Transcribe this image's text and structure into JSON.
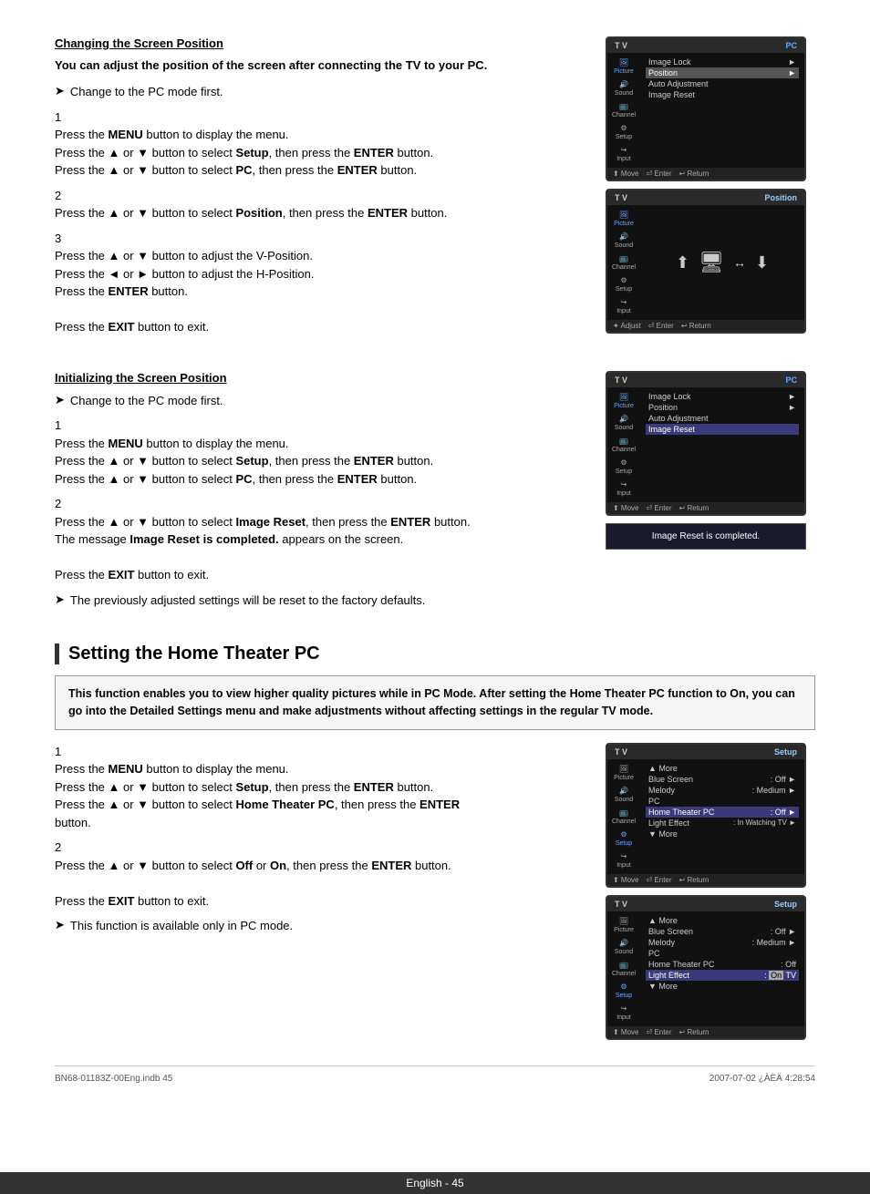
{
  "page": {
    "background": "#ffffff"
  },
  "section1": {
    "title": "Changing the Screen Position",
    "intro": "You can adjust the position of the screen after connecting the TV to your PC.",
    "arrow1": "Change to the PC mode first.",
    "step1_num": "1",
    "step1_line1": "Press the ",
    "step1_menu": "MENU",
    "step1_line1b": " button to display the menu.",
    "step1_line2a": "Press the ▲ or ▼ button to select ",
    "step1_setup": "Setup",
    "step1_line2b": ", then press the ",
    "step1_enter": "ENTER",
    "step1_line2c": " button.",
    "step1_line3a": "Press the ▲ or ▼ button to select ",
    "step1_pc": "PC",
    "step1_line3b": ", then press the ",
    "step1_enter2": "ENTER",
    "step1_line3c": " button.",
    "step2_num": "2",
    "step2_line1a": "Press the ▲ or ▼ button to select ",
    "step2_position": "Position",
    "step2_line1b": ", then press the ",
    "step2_enter": "ENTER",
    "step2_line1c": " button.",
    "step3_num": "3",
    "step3_line1": "Press the ▲ or ▼ button to adjust the V-Position.",
    "step3_line2": "Press the ◄ or ► button to adjust the H-Position.",
    "step3_line3a": "Press the ",
    "step3_enter": "ENTER",
    "step3_line3b": " button.",
    "step3_line4a": "Press the ",
    "step3_exit": "EXIT",
    "step3_line4b": " button to exit."
  },
  "tv1": {
    "header_tv": "T V",
    "header_pc": "PC",
    "menu_items": [
      {
        "label": "Image Lock",
        "arrow": "►",
        "selected": false
      },
      {
        "label": "Position",
        "arrow": "►",
        "selected": true
      },
      {
        "label": "Auto Adjustment",
        "arrow": "",
        "selected": false
      },
      {
        "label": "Image Reset",
        "arrow": "",
        "selected": false
      }
    ],
    "side_icons": [
      "Picture",
      "Sound",
      "Channel",
      "Setup",
      "Input"
    ],
    "footer": "⬆ Move  ⏎ Enter  ↩ Return"
  },
  "tv2": {
    "header_tv": "T V",
    "header_position": "Position",
    "side_icons": [
      "Picture",
      "Sound",
      "Channel",
      "Setup",
      "Input"
    ],
    "footer": "✦ Adjust  ⏎ Enter  ↩ Return"
  },
  "section2": {
    "title": "Initializing the Screen Position",
    "arrow1": "Change to the PC mode first.",
    "step1_num": "1",
    "step1_line1a": "Press the ",
    "step1_menu": "MENU",
    "step1_line1b": " button to display the menu.",
    "step1_line2a": "Press the ▲ or ▼ button to select ",
    "step1_setup": "Setup",
    "step1_line2b": ", then press the ",
    "step1_enter": "ENTER",
    "step1_line2c": " button.",
    "step1_line3a": "Press the ▲ or ▼ button to select ",
    "step1_pc": "PC",
    "step1_line3b": ", then press the ",
    "step1_enter2": "ENTER",
    "step1_line3c": " button.",
    "step2_num": "2",
    "step2_line1a": "Press the ▲ or ▼ button to select ",
    "step2_imgReset": "Image Reset",
    "step2_line1b": ", then press the ",
    "step2_enter": "ENTER",
    "step2_line1c": " button.",
    "step2_line2a": "The message ",
    "step2_msgBold": "Image Reset is completed.",
    "step2_line2b": " appears on the screen.",
    "step2_line3a": "Press the ",
    "step2_exit": "EXIT",
    "step2_line3b": " button to exit.",
    "arrow2": "The previously adjusted settings will be reset to the factory defaults."
  },
  "tv3": {
    "header_tv": "T V",
    "header_pc": "PC",
    "menu_items": [
      {
        "label": "Image Lock",
        "arrow": "►",
        "selected": false
      },
      {
        "label": "Position",
        "arrow": "►",
        "selected": false
      },
      {
        "label": "Auto Adjustment",
        "arrow": "",
        "selected": false
      },
      {
        "label": "Image Reset",
        "arrow": "",
        "selected": true
      }
    ],
    "side_icons": [
      "Picture",
      "Sound",
      "Channel",
      "Setup",
      "Input"
    ],
    "footer": "⬆ Move  ⏎ Enter  ↩ Return"
  },
  "imageResetMsg": "Image Reset is completed.",
  "section3": {
    "title": "Setting the Home Theater PC",
    "intro": "This function enables you to view higher quality pictures while in PC Mode. After setting the Home Theater PC function to On, you can go into the Detailed Settings menu and make adjustments without affecting settings in the regular TV mode.",
    "step1_num": "1",
    "step1_line1a": "Press the ",
    "step1_menu": "MENU",
    "step1_line1b": " button to display the menu.",
    "step1_line2a": "Press the ▲ or ▼ button to select ",
    "step1_setup": "Setup",
    "step1_line2b": ", then press the ",
    "step1_enter": "ENTER",
    "step1_line2c": " button.",
    "step1_line3a": "Press the ▲ or ▼ button to select ",
    "step1_htpc": "Home Theater PC",
    "step1_line3b": ", then press the ",
    "step1_enter2": "ENTER",
    "step1_line3c": " button.",
    "step2_num": "2",
    "step2_line1a": "Press the ▲ or ▼ button to select ",
    "step2_off": "Off",
    "step2_or": " or ",
    "step2_on": "On",
    "step2_line1b": ", then press the ",
    "step2_enter": "ENTER",
    "step2_line1c": " button.",
    "step2_line2a": "Press the ",
    "step2_exit": "EXIT",
    "step2_line2b": " button to exit.",
    "arrow1": "This function is available only in PC mode."
  },
  "tv4": {
    "header_tv": "T V",
    "header_setup": "Setup",
    "side_icons": [
      "Picture",
      "Sound",
      "Channel",
      "Setup",
      "Input"
    ],
    "menu_items": [
      {
        "label": "▲ More",
        "value": "",
        "selected": false
      },
      {
        "label": "Blue Screen",
        "value": ": Off",
        "arrow": "►",
        "selected": false
      },
      {
        "label": "Melody",
        "value": ": Medium",
        "arrow": "►",
        "selected": false
      },
      {
        "label": "PC",
        "value": "",
        "selected": false
      },
      {
        "label": "Home Theater PC",
        "value": ": Off",
        "arrow": "►",
        "selected": true
      },
      {
        "label": "Light Effect",
        "value": ": In Watching TV",
        "arrow": "►",
        "selected": false
      },
      {
        "label": "▼ More",
        "value": "",
        "selected": false
      }
    ],
    "footer": "⬆ Move  ⏎ Enter  ↩ Return"
  },
  "tv5": {
    "header_tv": "T V",
    "header_setup": "Setup",
    "side_icons": [
      "Picture",
      "Sound",
      "Channel",
      "Setup",
      "Input"
    ],
    "menu_items": [
      {
        "label": "▲ More",
        "value": "",
        "selected": false
      },
      {
        "label": "Blue Screen",
        "value": ": Off",
        "arrow": "►",
        "selected": false
      },
      {
        "label": "Melody",
        "value": ": Medium",
        "arrow": "►",
        "selected": false
      },
      {
        "label": "PC",
        "value": "",
        "selected": false
      },
      {
        "label": "Home Theater PC",
        "value": ": Off",
        "arrow": "",
        "selected": false
      },
      {
        "label": "Light Effect",
        "value": ": On  TV",
        "arrow": "",
        "selected": true
      },
      {
        "label": "▼ More",
        "value": "",
        "selected": false
      }
    ],
    "footer": "⬆ Move  ⏎ Enter  ↩ Return"
  },
  "bottomBar": {
    "language": "English",
    "pageInfo": "English - 45"
  },
  "footerInfo": {
    "left": "BN68-01183Z-00Eng.indb   45",
    "right": "2007-07-02   ¿ÀÈÄ 4:28:54"
  }
}
